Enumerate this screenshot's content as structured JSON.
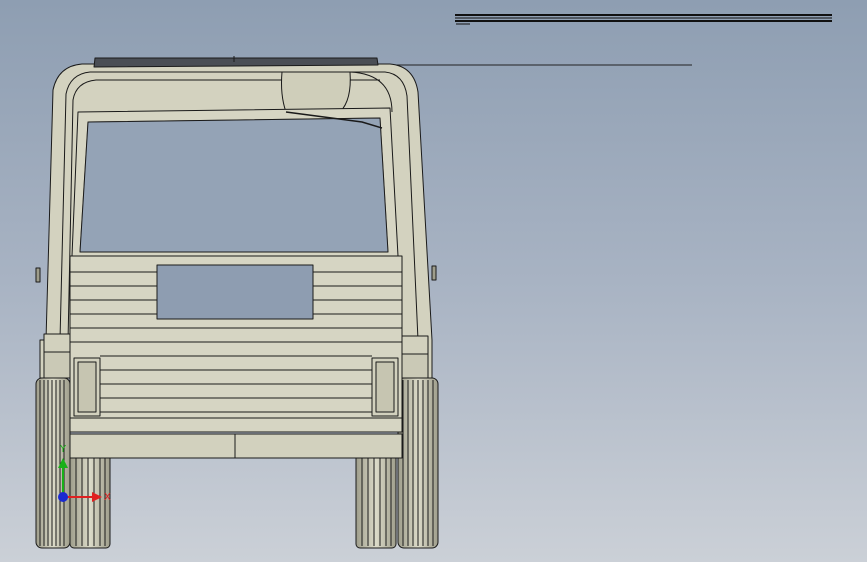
{
  "viewport": {
    "background_top": "#8f9fb3",
    "background_bottom": "#c9ced6",
    "model_fill": "#d6d5c3",
    "edge_color": "#1a1a1a",
    "wheel_fill": "#c8c7b3"
  },
  "triad": {
    "x_label": "X",
    "y_label": "Y",
    "x_color": "#e02020",
    "y_color": "#18b018",
    "z_color": "#1a2ad0"
  }
}
